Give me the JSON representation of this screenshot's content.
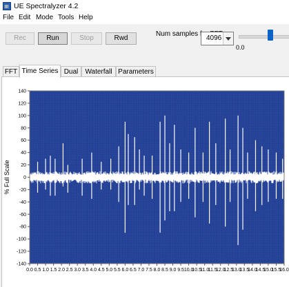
{
  "window": {
    "title": "UE Spectralyzer 4.2",
    "icon": "spectrum-app-icon"
  },
  "menu": [
    "File",
    "Edit",
    "Mode",
    "Tools",
    "Help"
  ],
  "toolbar": {
    "buttons": [
      {
        "label": "Rec",
        "state": "disabled"
      },
      {
        "label": "Run",
        "state": "active"
      },
      {
        "label": "Stop",
        "state": "disabled"
      },
      {
        "label": "Rwd",
        "state": "enabled"
      }
    ],
    "num_samples_label": "Num samples for FFT:",
    "num_samples_value": "4096",
    "slider_min_label": "0.0",
    "slider_level": 0.65
  },
  "tabs": [
    {
      "label": "FFT",
      "active": false
    },
    {
      "label": "Time Series",
      "active": true
    },
    {
      "label": "Dual",
      "active": false
    },
    {
      "label": "Waterfall",
      "active": false
    },
    {
      "label": "Parameters",
      "active": false
    }
  ],
  "colors": {
    "plot_background": "#1f3c8f",
    "grid": "#3d5ab2",
    "trace": "#ffffff",
    "slider_thumb": "#0a63c7"
  },
  "chart_data": {
    "type": "line",
    "ylabel": "% Full Scale",
    "xlabel": "",
    "xlim": [
      0.0,
      16.0
    ],
    "ylim": [
      -140,
      140
    ],
    "x_ticks": [
      "0.0",
      "0.5",
      "1.0",
      "1.5",
      "2.0",
      "2.5",
      "3.0",
      "3.5",
      "4.0",
      "4.5",
      "5.0",
      "5.5",
      "6.0",
      "6.5",
      "7.0",
      "7.5",
      "8.0",
      "8.5",
      "9.0",
      "9.5",
      "10.0",
      "10.5",
      "11.0",
      "11.5",
      "12.0",
      "12.5",
      "13.0",
      "13.5",
      "14.0",
      "14.5",
      "15.0",
      "15.5",
      "16.0"
    ],
    "y_ticks": [
      "140",
      "120",
      "100",
      "80",
      "60",
      "40",
      "20",
      "0",
      "-20",
      "-40",
      "-60",
      "-80",
      "-100",
      "-120",
      "-140"
    ],
    "grid": true,
    "series": [
      {
        "baseline_band": [
          -10,
          10
        ],
        "spikes": [
          {
            "x": 0.5,
            "min": -25,
            "max": 25
          },
          {
            "x": 1.0,
            "min": -20,
            "max": 30
          },
          {
            "x": 1.3,
            "min": -30,
            "max": 35
          },
          {
            "x": 1.6,
            "min": -30,
            "max": 30
          },
          {
            "x": 2.1,
            "min": -15,
            "max": 55
          },
          {
            "x": 2.4,
            "min": -25,
            "max": 20
          },
          {
            "x": 3.3,
            "min": -30,
            "max": 30
          },
          {
            "x": 3.9,
            "min": -35,
            "max": 40
          },
          {
            "x": 4.5,
            "min": -20,
            "max": 25
          },
          {
            "x": 5.1,
            "min": -20,
            "max": 30
          },
          {
            "x": 5.6,
            "min": -40,
            "max": 50
          },
          {
            "x": 6.0,
            "min": -90,
            "max": 90
          },
          {
            "x": 6.2,
            "min": -45,
            "max": 70
          },
          {
            "x": 6.6,
            "min": -45,
            "max": 65
          },
          {
            "x": 6.9,
            "min": -20,
            "max": 45
          },
          {
            "x": 7.2,
            "min": -30,
            "max": 35
          },
          {
            "x": 7.7,
            "min": -35,
            "max": 35
          },
          {
            "x": 8.2,
            "min": -90,
            "max": 90
          },
          {
            "x": 8.5,
            "min": -70,
            "max": 100
          },
          {
            "x": 8.8,
            "min": -55,
            "max": 55
          },
          {
            "x": 9.1,
            "min": -55,
            "max": 85
          },
          {
            "x": 9.5,
            "min": -40,
            "max": 45
          },
          {
            "x": 10.0,
            "min": -35,
            "max": 40
          },
          {
            "x": 10.4,
            "min": -65,
            "max": 80
          },
          {
            "x": 10.9,
            "min": -40,
            "max": 40
          },
          {
            "x": 11.3,
            "min": -75,
            "max": 90
          },
          {
            "x": 11.7,
            "min": -45,
            "max": 55
          },
          {
            "x": 12.3,
            "min": -80,
            "max": 95
          },
          {
            "x": 12.6,
            "min": -40,
            "max": 45
          },
          {
            "x": 13.1,
            "min": -110,
            "max": 100
          },
          {
            "x": 13.4,
            "min": -85,
            "max": 80
          },
          {
            "x": 13.7,
            "min": -35,
            "max": 40
          },
          {
            "x": 14.2,
            "min": -55,
            "max": 60
          },
          {
            "x": 14.6,
            "min": -45,
            "max": 50
          },
          {
            "x": 15.0,
            "min": -40,
            "max": 45
          },
          {
            "x": 15.5,
            "min": -35,
            "max": 40
          },
          {
            "x": 15.9,
            "min": -35,
            "max": 30
          }
        ]
      }
    ]
  }
}
